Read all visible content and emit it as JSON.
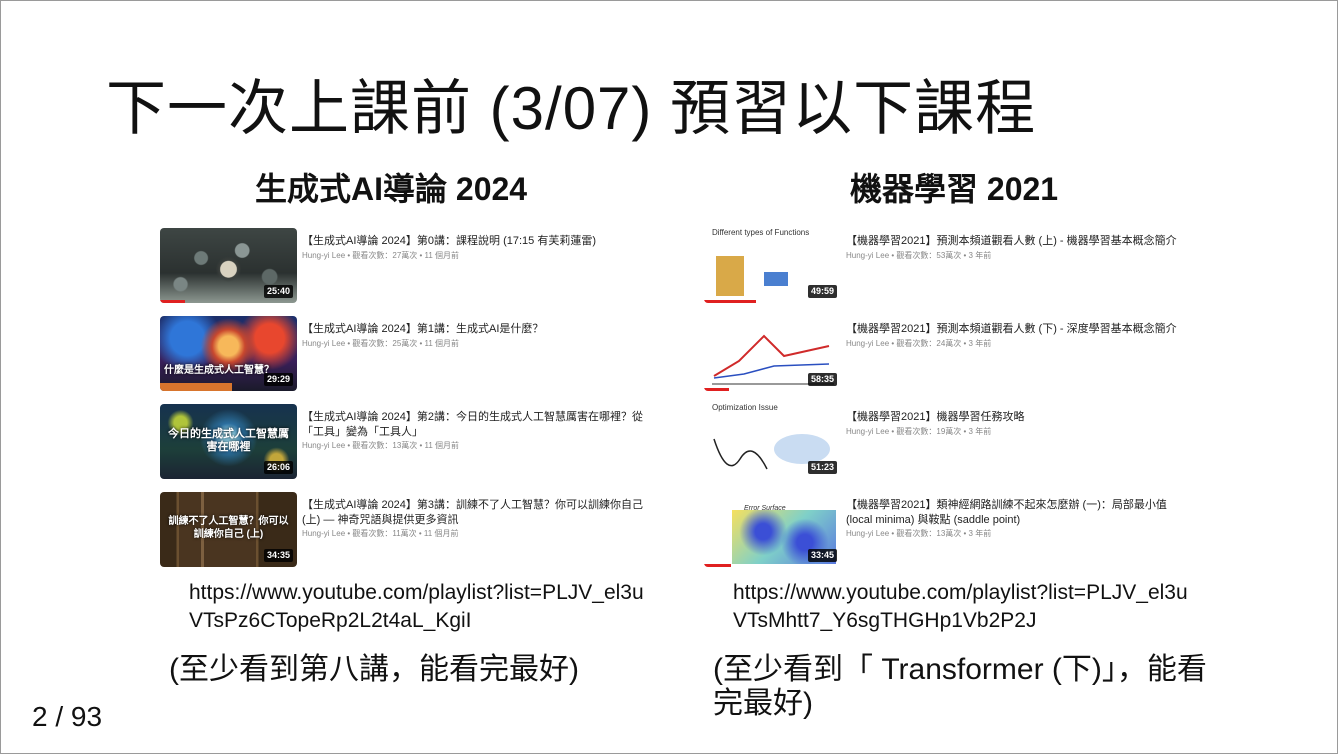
{
  "slide": {
    "title": "下一次上課前 (3/07) 預習以下課程",
    "page_number": "2 / 93"
  },
  "left": {
    "heading": "生成式AI導論 2024",
    "videos": [
      {
        "title": "【生成式AI導論 2024】第0講：課程說明 (17:15 有芙莉蓮雷)",
        "meta": "Hung-yi Lee • 觀看次數：27萬次 • 11 個月前",
        "duration": "25:40",
        "caption": "",
        "progress": 0.18
      },
      {
        "title": "【生成式AI導論 2024】第1講：生成式AI是什麼？",
        "meta": "Hung-yi Lee • 觀看次數：25萬次 • 11 個月前",
        "duration": "29:29",
        "caption": "什麼是生成式人工智慧？",
        "progress": 0.0
      },
      {
        "title": "【生成式AI導論 2024】第2講：今日的生成式人工智慧厲害在哪裡？從「工具」變為「工具人」",
        "meta": "Hung-yi Lee • 觀看次數：13萬次 • 11 個月前",
        "duration": "26:06",
        "caption": "今日的生成式人工智慧厲害在哪裡",
        "progress": 0.0
      },
      {
        "title": "【生成式AI導論 2024】第3講：訓練不了人工智慧？你可以訓練你自己 (上) — 神奇咒語與提供更多資訊",
        "meta": "Hung-yi Lee • 觀看次數：11萬次 • 11 個月前",
        "duration": "34:35",
        "caption": "訓練不了人工智慧？你可以訓練你自己 (上)",
        "progress": 0.0
      }
    ],
    "link": "https://www.youtube.com/playlist?list=PLJV_el3uVTsPz6CTopeRp2L2t4aL_KgiI",
    "note": "(至少看到第八講，能看完最好)"
  },
  "right": {
    "heading": "機器學習 2021",
    "videos": [
      {
        "title": "【機器學習2021】預測本頻道觀看人數 (上) - 機器學習基本概念簡介",
        "meta": "Hung-yi Lee • 觀看次數：53萬次 • 3 年前",
        "duration": "49:59",
        "caption": "Different types of Functions",
        "progress": 0.38
      },
      {
        "title": "【機器學習2021】預測本頻道觀看人數 (下) - 深度學習基本概念簡介",
        "meta": "Hung-yi Lee • 觀看次數：24萬次 • 3 年前",
        "duration": "58:35",
        "caption": "",
        "progress": 0.18
      },
      {
        "title": "【機器學習2021】機器學習任務攻略",
        "meta": "Hung-yi Lee • 觀看次數：19萬次 • 3 年前",
        "duration": "51:23",
        "caption": "Optimization Issue",
        "progress": 0.0
      },
      {
        "title": "【機器學習2021】類神經網路訓練不起來怎麼辦 (一)：局部最小值 (local minima) 與鞍點 (saddle point)",
        "meta": "Hung-yi Lee • 觀看次數：13萬次 • 3 年前",
        "duration": "33:45",
        "caption": "Error Surface",
        "progress": 0.2
      }
    ],
    "link": "https://www.youtube.com/playlist?list=PLJV_el3uVTsMhtt7_Y6sgTHGHp1Vb2P2J",
    "note": "(至少看到「 Transformer (下)」，能看完最好)"
  }
}
